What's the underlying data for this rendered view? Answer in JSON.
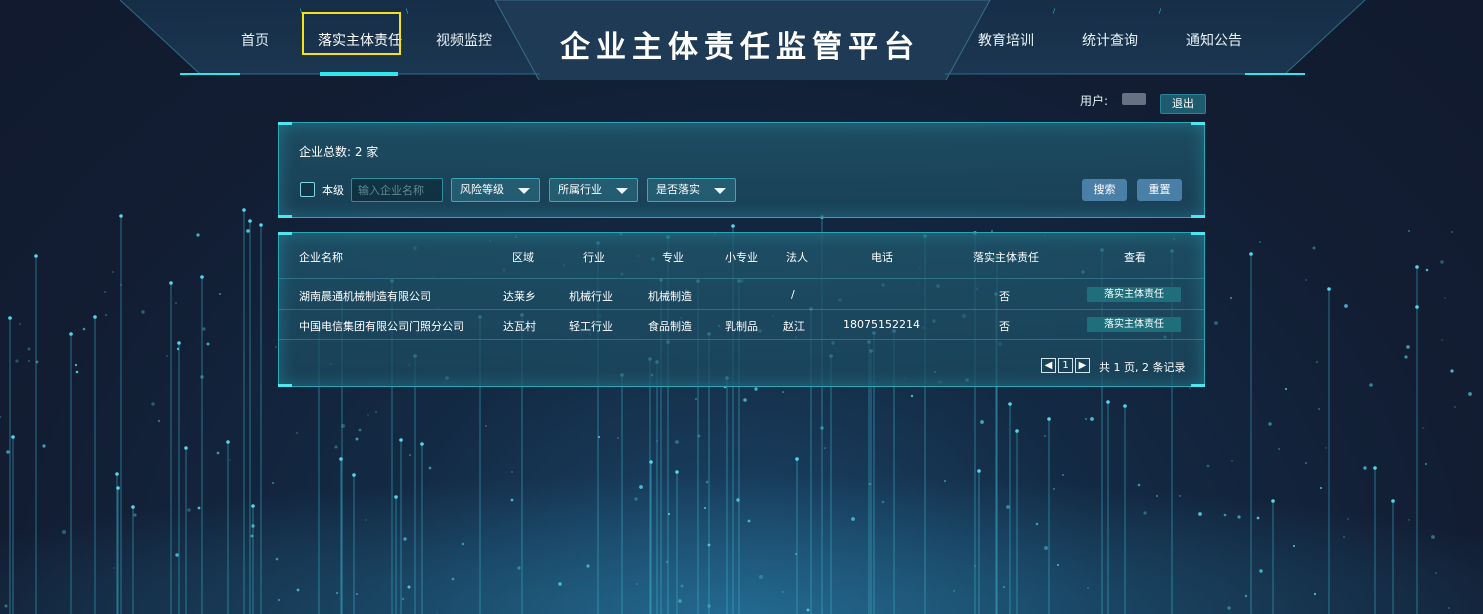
{
  "header": {
    "title": "企业主体责任监管平台",
    "nav_left": [
      "首页",
      "落实主体责任",
      "视频监控"
    ],
    "nav_right": [
      "教育培训",
      "统计查询",
      "通知公告"
    ],
    "active": "落实主体责任"
  },
  "user": {
    "label": "用户:",
    "logout": "退出"
  },
  "filter": {
    "count_label": "企业总数: 2 家",
    "checkbox_label": "本级",
    "search_placeholder": "输入企业名称",
    "risk_select": "风险等级",
    "industry_select": "所属行业",
    "implemented_select": "是否落实",
    "search_button": "搜索",
    "reset_button": "重置"
  },
  "table": {
    "headers": [
      "企业名称",
      "区域",
      "行业",
      "专业",
      "小专业",
      "法人",
      "电话",
      "落实主体责任",
      "查看"
    ],
    "rows": [
      {
        "name": "湖南晨通机械制造有限公司",
        "region": "达莱乡",
        "industry": "机械行业",
        "major": "机械制造",
        "sub_major": "",
        "legal": "/",
        "phone": "",
        "implemented": "否",
        "action": "落实主体责任"
      },
      {
        "name": "中国电信集团有限公司门照分公司",
        "region": "达瓦村",
        "industry": "轻工行业",
        "major": "食品制造",
        "sub_major": "乳制品",
        "legal": "赵江",
        "phone": "18075152214",
        "implemented": "否",
        "action": "落实主体责任"
      }
    ],
    "pager": {
      "page": "1",
      "summary": "共 1 页, 2 条记录"
    }
  },
  "colors": {
    "accent": "#2ee8ee",
    "highlight": "#f5e21b",
    "button": "#4a7fa8",
    "row_button": "#1e6e7c"
  }
}
